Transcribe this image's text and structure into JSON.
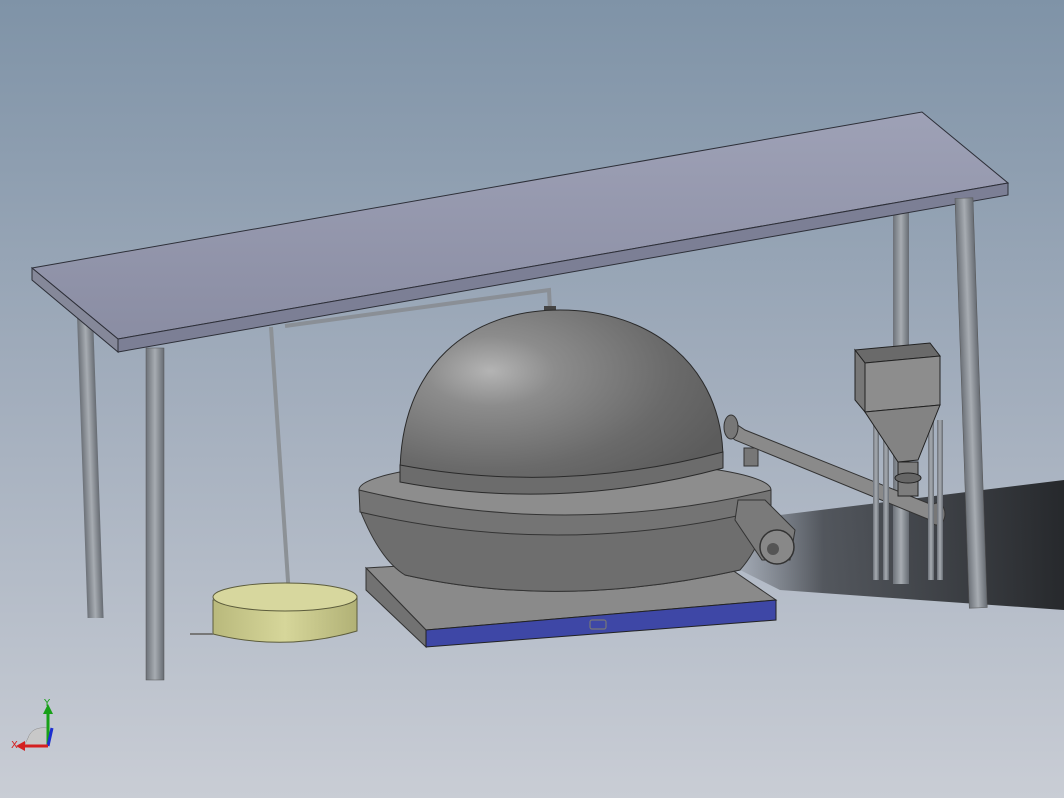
{
  "viewport": {
    "background_top": "#7f93a7",
    "background_bottom": "#c9cdd5"
  },
  "triad": {
    "x_label": "X",
    "y_label": "Y",
    "x_color": "#d42020",
    "y_color": "#18a018",
    "z_color": "#1c2fd0"
  },
  "model": {
    "canopy_color": "#9497ad",
    "dome_color": "#777777",
    "base_trim_color": "#3e47a6",
    "tank_color": "#c8c88a"
  }
}
